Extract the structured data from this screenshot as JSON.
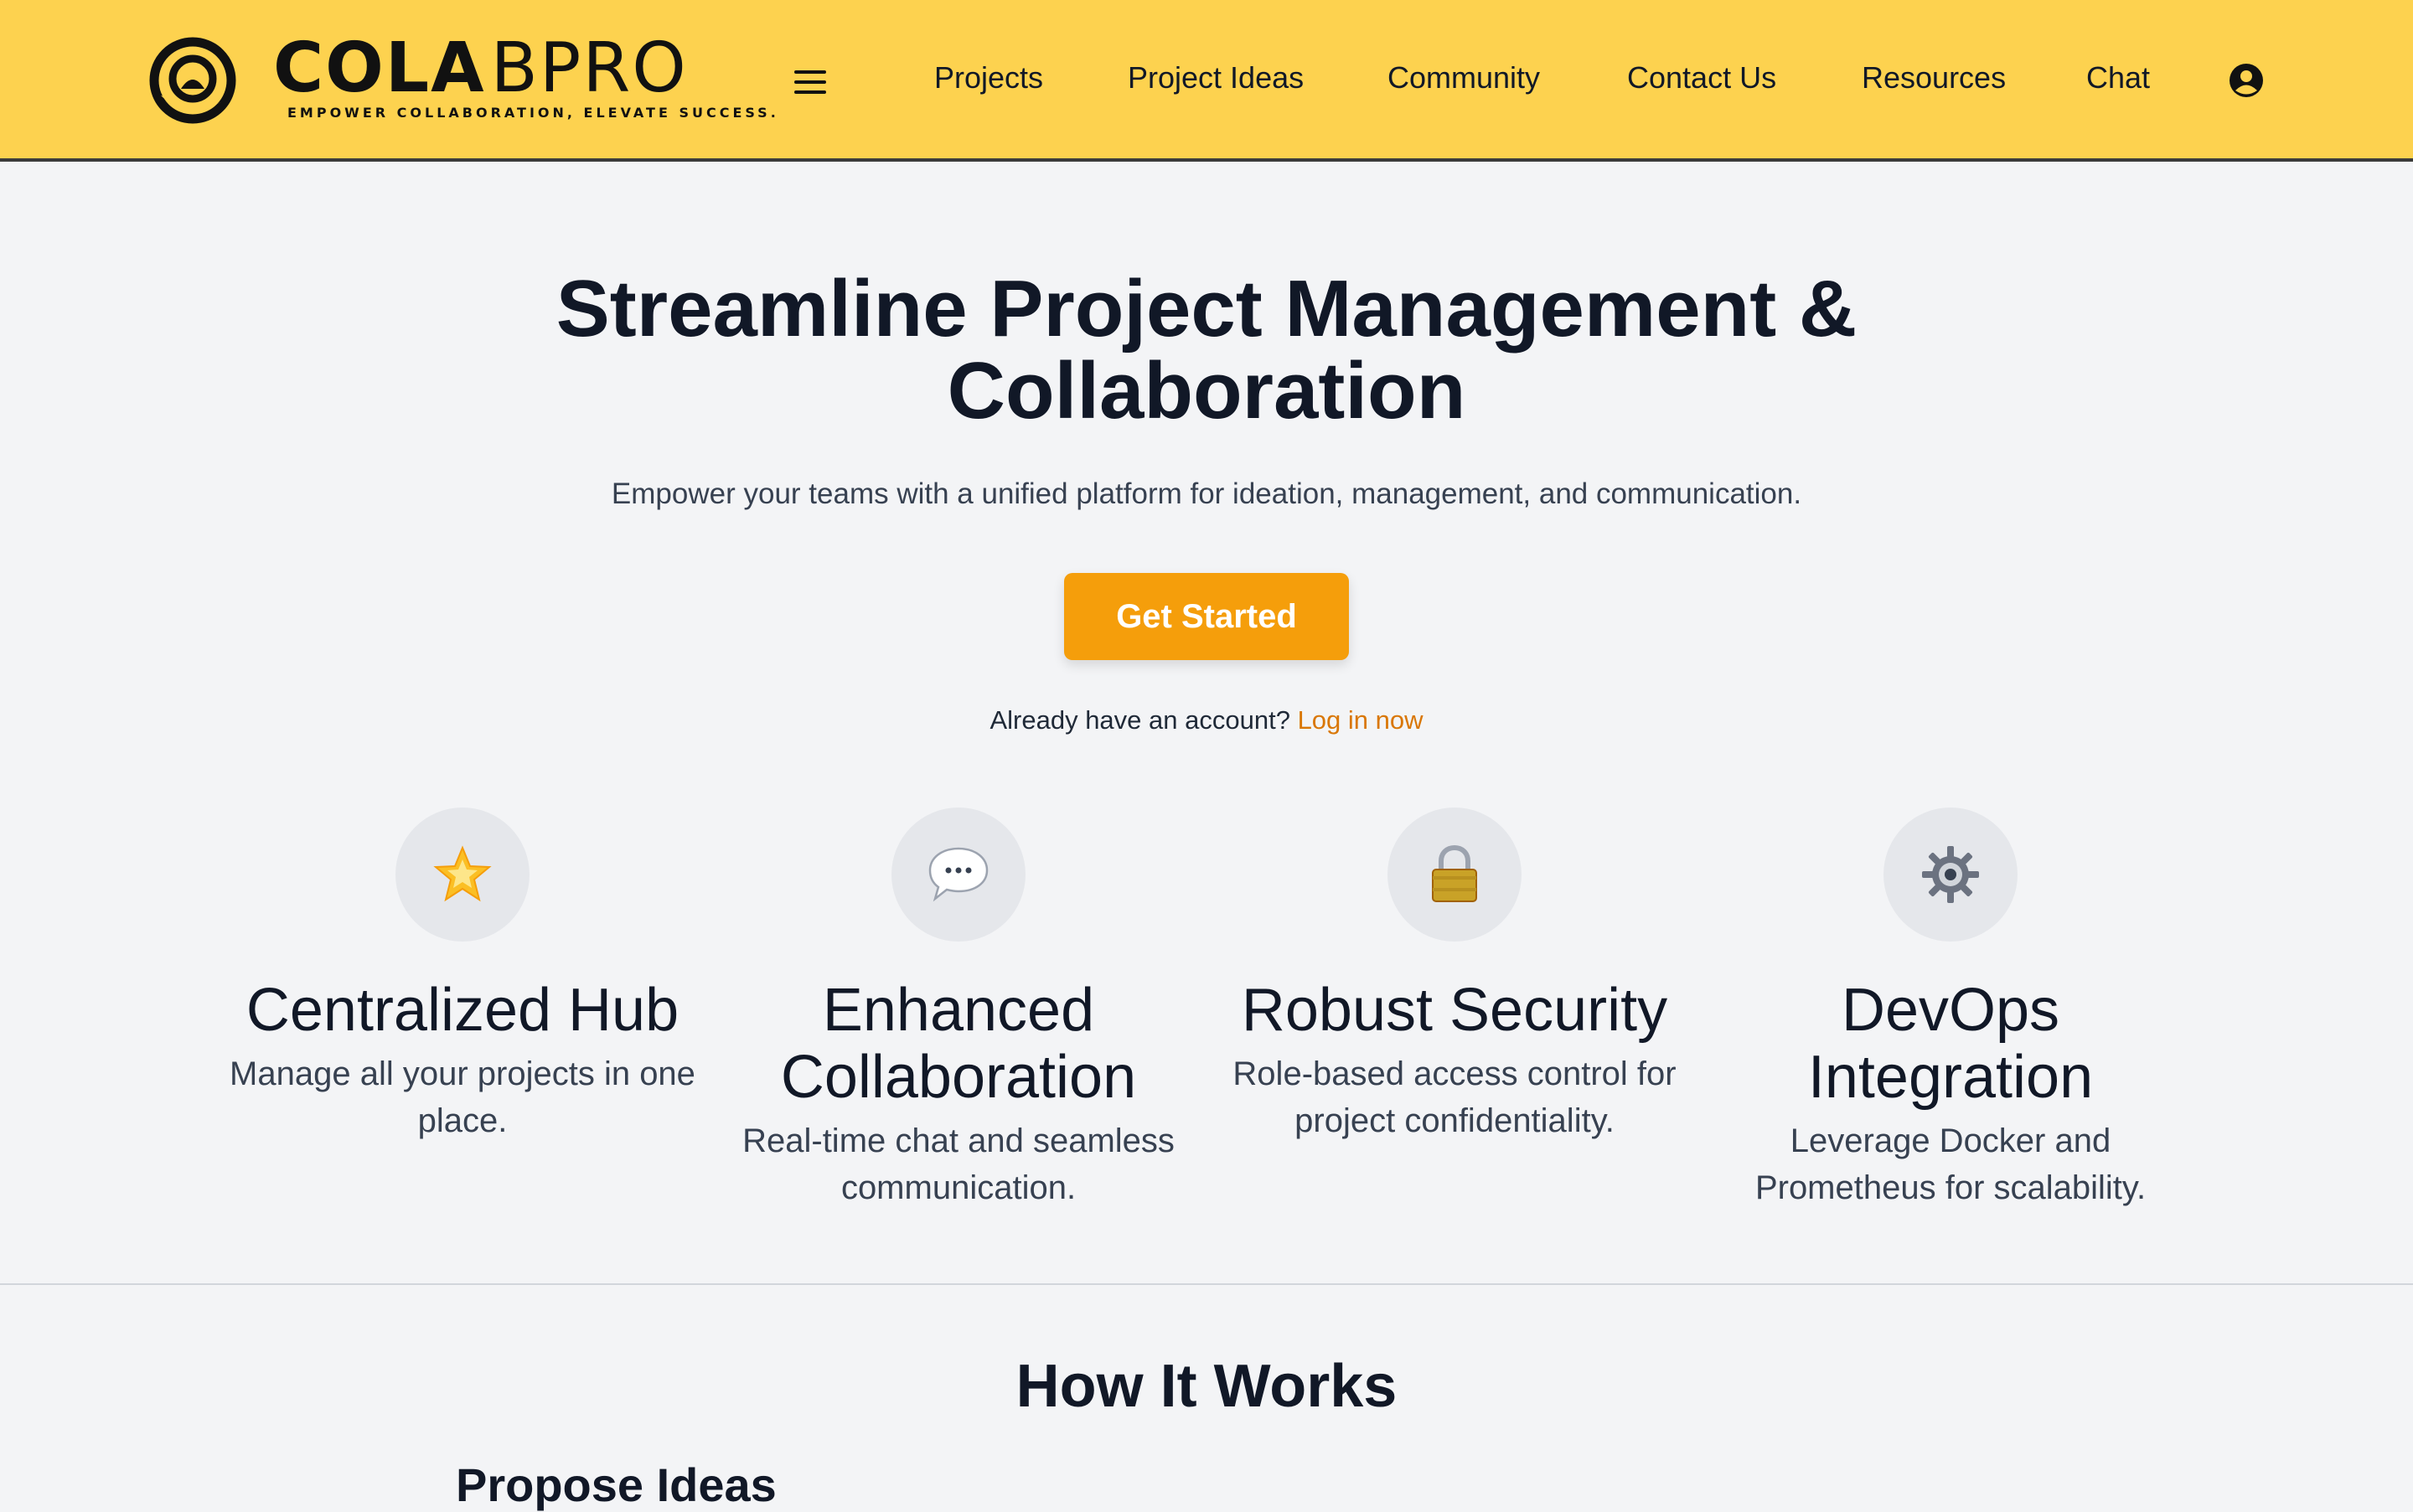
{
  "brand": {
    "name_bold": "COLA",
    "name_light": "BPRO",
    "tagline": "EMPOWER COLLABORATION, ELEVATE SUCCESS."
  },
  "icons": {
    "logo": "swirl-logo-icon",
    "menu": "hamburger-menu-icon",
    "user": "user-account-icon"
  },
  "nav": {
    "items": [
      {
        "label": "Projects"
      },
      {
        "label": "Project Ideas"
      },
      {
        "label": "Community"
      },
      {
        "label": "Contact Us"
      },
      {
        "label": "Resources"
      },
      {
        "label": "Chat"
      }
    ]
  },
  "hero": {
    "title_line1": "Streamline Project Management &",
    "title_line2": "Collaboration",
    "subtitle": "Empower your teams with a unified platform for ideation, management, and communication.",
    "cta_label": "Get Started",
    "login_prompt": "Already have an account?",
    "login_link": "Log in now"
  },
  "features": [
    {
      "icon": "star-icon",
      "title": "Centralized Hub",
      "desc": "Manage all your projects in one place."
    },
    {
      "icon": "speech-bubble-icon",
      "title": "Enhanced Collaboration",
      "desc": "Real-time chat and seamless communication."
    },
    {
      "icon": "padlock-icon",
      "title": "Robust Security",
      "desc": "Role-based access control for project confidentiality."
    },
    {
      "icon": "gear-icon",
      "title": "DevOps Integration",
      "desc": "Leverage Docker and Prometheus for scalability."
    }
  ],
  "how_it_works": {
    "title": "How It Works",
    "first_step": "Propose Ideas"
  },
  "colors": {
    "header_bg": "#fdd24f",
    "cta_bg": "#f59e0b",
    "link": "#d97706",
    "page_bg": "#f3f4f6"
  }
}
